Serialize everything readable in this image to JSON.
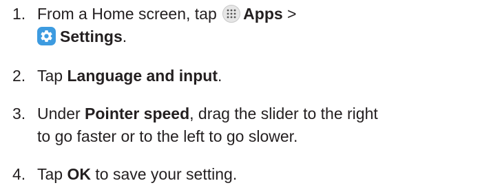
{
  "steps": [
    {
      "number": "1.",
      "text_a": "From a Home screen, tap",
      "apps_label": "Apps",
      "sep": " >",
      "settings_label": "Settings",
      "period": ".",
      "icons": [
        "apps-icon",
        "settings-icon"
      ]
    },
    {
      "number": "2.",
      "text_a": "Tap ",
      "bold": "Language and input",
      "period": "."
    },
    {
      "number": "3.",
      "text_a": "Under ",
      "bold": "Pointer speed",
      "text_b": ", drag the slider to the right",
      "line2": "to go faster or to the left to go slower."
    },
    {
      "number": "4.",
      "text_a": "Tap ",
      "bold": "OK",
      "text_b": " to save your setting."
    }
  ],
  "colors": {
    "text": "#231f20",
    "settings_icon": "#3d9be0"
  }
}
